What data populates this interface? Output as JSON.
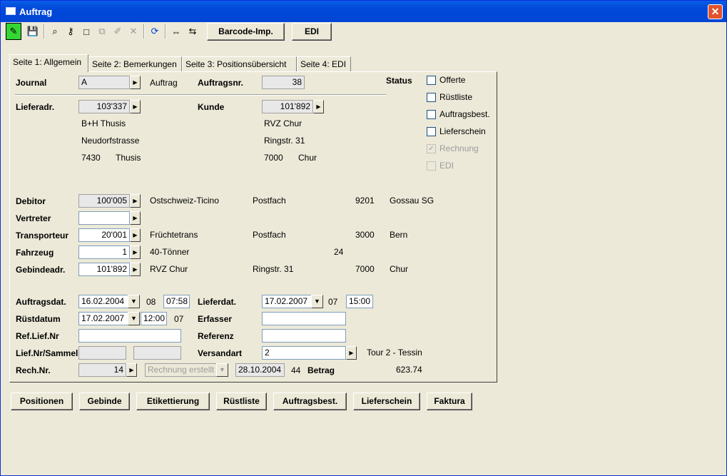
{
  "window": {
    "title": "Auftrag",
    "close": "✕"
  },
  "toolbar": {
    "barcode": "Barcode-Imp.",
    "edi": "EDI"
  },
  "tabs": [
    "Seite 1: Allgemein",
    "Seite 2: Bemerkungen",
    "Seite 3: Positionsübersicht",
    "Seite 4: EDI"
  ],
  "header": {
    "journal_label": "Journal",
    "journal_value": "A",
    "journal_text": "Auftrag",
    "auftragsnr_label": "Auftragsnr.",
    "auftragsnr_value": "38"
  },
  "status": {
    "label": "Status",
    "items": [
      {
        "label": "Offerte",
        "checked": false,
        "disabled": false
      },
      {
        "label": "Rüstliste",
        "checked": false,
        "disabled": false
      },
      {
        "label": "Auftragsbest.",
        "checked": false,
        "disabled": false
      },
      {
        "label": "Lieferschein",
        "checked": false,
        "disabled": false
      },
      {
        "label": "Rechnung",
        "checked": true,
        "disabled": true
      },
      {
        "label": "EDI",
        "checked": false,
        "disabled": true
      }
    ]
  },
  "liefer": {
    "label": "Lieferadr.",
    "value": "103'337",
    "name": "B+H Thusis",
    "street": "Neudorfstrasse",
    "plz": "7430",
    "city": "Thusis"
  },
  "kunde": {
    "label": "Kunde",
    "value": "101'892",
    "name": "RVZ Chur",
    "street": "Ringstr. 31",
    "plz": "7000",
    "city": "Chur"
  },
  "debitor": {
    "label": "Debitor",
    "value": "100'005",
    "name": "Ostschweiz-Ticino",
    "street": "Postfach",
    "plz": "9201",
    "city": "Gossau SG"
  },
  "vertreter": {
    "label": "Vertreter",
    "value": ""
  },
  "transporteur": {
    "label": "Transporteur",
    "value": "20'001",
    "name": "Früchtetrans",
    "street": "Postfach",
    "plz": "3000",
    "city": "Bern"
  },
  "fahrzeug": {
    "label": "Fahrzeug",
    "value": "1",
    "name": "40-Tönner",
    "extra": "24"
  },
  "gebinde": {
    "label": "Gebindeadr.",
    "value": "101'892",
    "name": "RVZ Chur",
    "street": "Ringstr. 31",
    "plz": "7000",
    "city": "Chur"
  },
  "auftragsdat": {
    "label": "Auftragsdat.",
    "date": "16.02.2004",
    "week": "08",
    "time": "07:58"
  },
  "lieferdat": {
    "label": "Lieferdat.",
    "date": "17.02.2007",
    "week": "07",
    "time": "15:00"
  },
  "ruestdatum": {
    "label": "Rüstdatum",
    "date": "17.02.2007",
    "time": "12:00",
    "week": "07"
  },
  "erfasser": {
    "label": "Erfasser",
    "value": ""
  },
  "reflief": {
    "label": "Ref.Lief.Nr",
    "value": ""
  },
  "referenz": {
    "label": "Referenz",
    "value": ""
  },
  "liefnr": {
    "label": "Lief.Nr/Sammel",
    "value1": "",
    "value2": ""
  },
  "versandart": {
    "label": "Versandart",
    "value": "2",
    "text": "Tour 2 - Tessin"
  },
  "rech": {
    "label": "Rech.Nr.",
    "value": "14",
    "status": "Rechnung erstellt",
    "date": "28.10.2004",
    "week": "44",
    "betrag_label": "Betrag",
    "betrag": "623.74"
  },
  "buttons": {
    "positionen": "Positionen",
    "gebinde": "Gebinde",
    "etikettierung": "Etikettierung",
    "ruestliste": "Rüstliste",
    "auftragsbest": "Auftragsbest.",
    "lieferschein": "Lieferschein",
    "faktura": "Faktura"
  }
}
